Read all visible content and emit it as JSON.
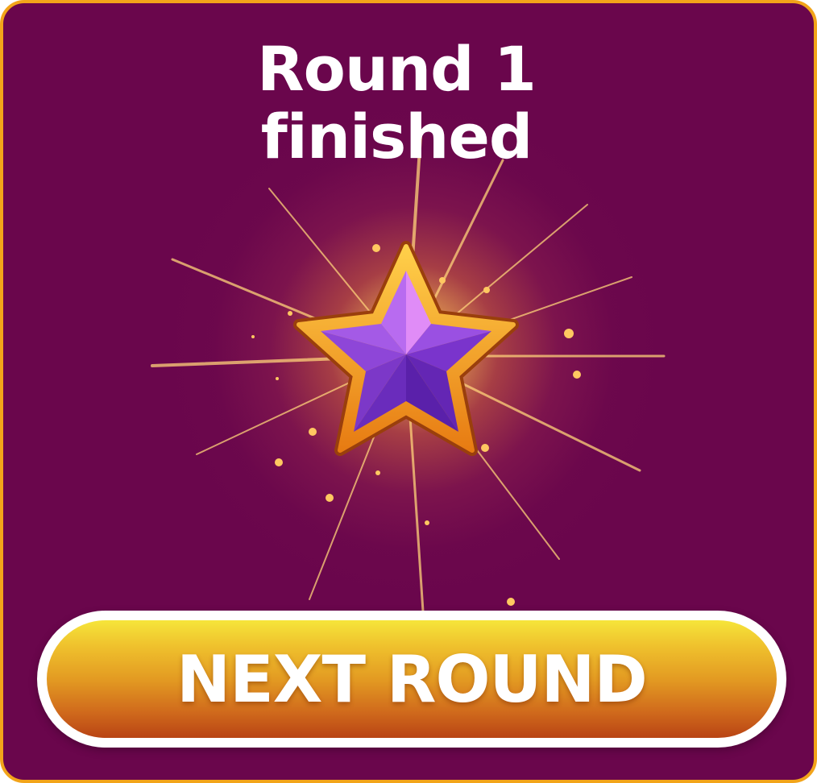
{
  "dialog": {
    "title_line1": "Round 1",
    "title_line2": "finished",
    "next_button_label": "NEXT ROUND"
  },
  "icons": {
    "reward": "star-icon"
  },
  "colors": {
    "panel_background": "#6a064c",
    "panel_border": "#f2a41a",
    "star_fill": "#8a40d8",
    "star_rim": "#f39a1c",
    "button_top": "#f6e53a",
    "button_bottom": "#b94414",
    "text": "#ffffff"
  }
}
